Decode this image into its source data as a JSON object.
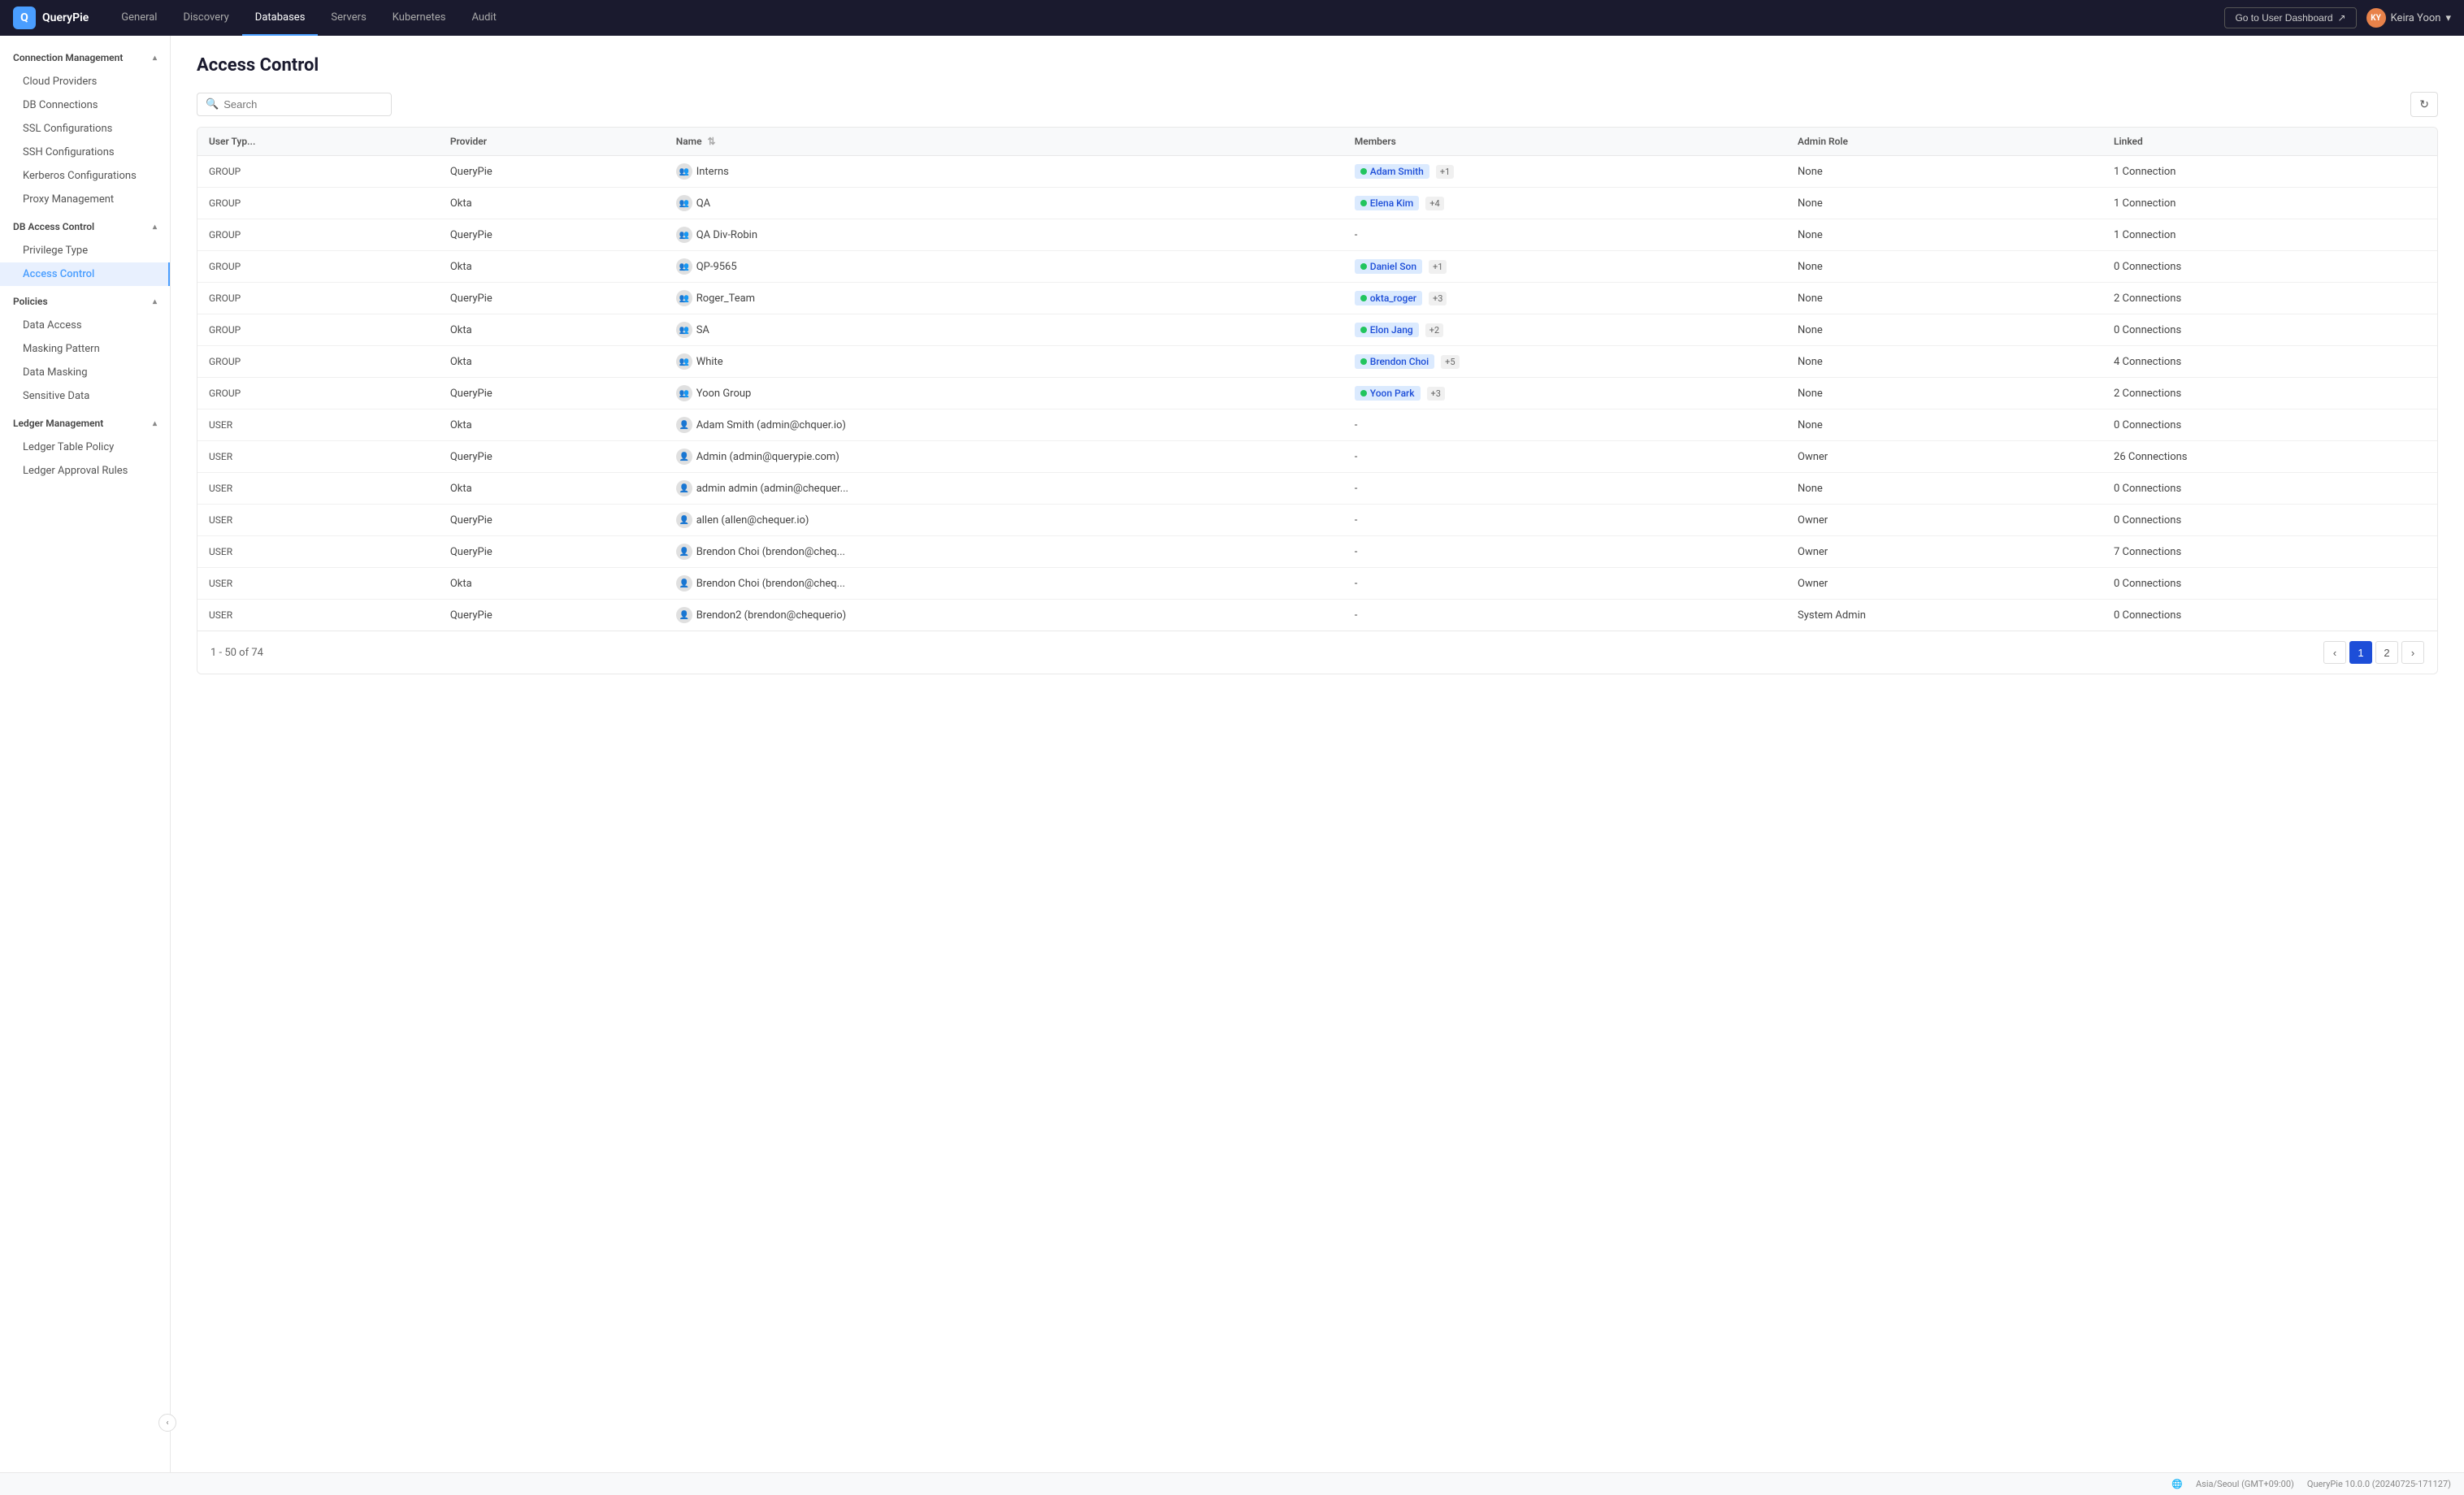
{
  "app": {
    "name": "QueryPie",
    "logo_char": "Q"
  },
  "nav": {
    "tabs": [
      {
        "id": "general",
        "label": "General",
        "active": false
      },
      {
        "id": "discovery",
        "label": "Discovery",
        "active": false
      },
      {
        "id": "databases",
        "label": "Databases",
        "active": true
      },
      {
        "id": "servers",
        "label": "Servers",
        "active": false
      },
      {
        "id": "kubernetes",
        "label": "Kubernetes",
        "active": false
      },
      {
        "id": "audit",
        "label": "Audit",
        "active": false
      }
    ],
    "dashboard_btn": "Go to User Dashboard",
    "user_name": "Keira Yoon",
    "user_initials": "KY"
  },
  "sidebar": {
    "sections": [
      {
        "id": "connection-management",
        "label": "Connection Management",
        "expanded": true,
        "items": [
          {
            "id": "cloud-providers",
            "label": "Cloud Providers",
            "active": false
          },
          {
            "id": "db-connections",
            "label": "DB Connections",
            "active": false
          },
          {
            "id": "ssl-configurations",
            "label": "SSL Configurations",
            "active": false
          },
          {
            "id": "ssh-configurations",
            "label": "SSH Configurations",
            "active": false
          },
          {
            "id": "kerberos-configurations",
            "label": "Kerberos Configurations",
            "active": false
          },
          {
            "id": "proxy-management",
            "label": "Proxy Management",
            "active": false
          }
        ]
      },
      {
        "id": "db-access-control",
        "label": "DB Access Control",
        "expanded": true,
        "items": [
          {
            "id": "privilege-type",
            "label": "Privilege Type",
            "active": false
          },
          {
            "id": "access-control",
            "label": "Access Control",
            "active": true
          }
        ]
      },
      {
        "id": "policies",
        "label": "Policies",
        "expanded": true,
        "items": [
          {
            "id": "data-access",
            "label": "Data Access",
            "active": false
          },
          {
            "id": "masking-pattern",
            "label": "Masking Pattern",
            "active": false
          },
          {
            "id": "data-masking",
            "label": "Data Masking",
            "active": false
          },
          {
            "id": "sensitive-data",
            "label": "Sensitive Data",
            "active": false
          }
        ]
      },
      {
        "id": "ledger-management",
        "label": "Ledger Management",
        "expanded": true,
        "items": [
          {
            "id": "ledger-table-policy",
            "label": "Ledger Table Policy",
            "active": false
          },
          {
            "id": "ledger-approval-rules",
            "label": "Ledger Approval Rules",
            "active": false
          }
        ]
      }
    ]
  },
  "page": {
    "title": "Access Control",
    "search_placeholder": "Search",
    "pagination_info": "1 - 50 of 74",
    "current_page": 1,
    "total_pages": 2
  },
  "table": {
    "columns": [
      {
        "id": "user-type",
        "label": "User Typ...",
        "sortable": false
      },
      {
        "id": "provider",
        "label": "Provider",
        "sortable": false
      },
      {
        "id": "name",
        "label": "Name",
        "sortable": true
      },
      {
        "id": "members",
        "label": "Members",
        "sortable": false
      },
      {
        "id": "admin-role",
        "label": "Admin Role",
        "sortable": false
      },
      {
        "id": "linked",
        "label": "Linked",
        "sortable": false
      }
    ],
    "rows": [
      {
        "user_type": "GROUP",
        "provider": "QueryPie",
        "name": "Interns",
        "members": [
          {
            "label": "Adam Smith",
            "has_dot": true
          }
        ],
        "members_plus": "+1",
        "admin_role": "None",
        "linked": "1 Connection"
      },
      {
        "user_type": "GROUP",
        "provider": "Okta",
        "name": "QA",
        "members": [
          {
            "label": "Elena Kim",
            "has_dot": true
          }
        ],
        "members_plus": "+4",
        "admin_role": "None",
        "linked": "1 Connection"
      },
      {
        "user_type": "GROUP",
        "provider": "QueryPie",
        "name": "QA Div-Robin",
        "members": [],
        "members_plus": "",
        "admin_role": "None",
        "linked": "1 Connection"
      },
      {
        "user_type": "GROUP",
        "provider": "Okta",
        "name": "QP-9565",
        "members": [
          {
            "label": "Daniel Son",
            "has_dot": true
          }
        ],
        "members_plus": "+1",
        "admin_role": "None",
        "linked": "0 Connections"
      },
      {
        "user_type": "GROUP",
        "provider": "QueryPie",
        "name": "Roger_Team",
        "members": [
          {
            "label": "okta_roger",
            "has_dot": true
          }
        ],
        "members_plus": "+3",
        "admin_role": "None",
        "linked": "2 Connections"
      },
      {
        "user_type": "GROUP",
        "provider": "Okta",
        "name": "SA",
        "members": [
          {
            "label": "Elon Jang",
            "has_dot": true
          }
        ],
        "members_plus": "+2",
        "admin_role": "None",
        "linked": "0 Connections"
      },
      {
        "user_type": "GROUP",
        "provider": "Okta",
        "name": "White",
        "members": [
          {
            "label": "Brendon Choi",
            "has_dot": true
          }
        ],
        "members_plus": "+5",
        "admin_role": "None",
        "linked": "4 Connections"
      },
      {
        "user_type": "GROUP",
        "provider": "QueryPie",
        "name": "Yoon Group",
        "members": [
          {
            "label": "Yoon Park",
            "has_dot": true
          }
        ],
        "members_plus": "+3",
        "admin_role": "None",
        "linked": "2 Connections"
      },
      {
        "user_type": "USER",
        "provider": "Okta",
        "name": "Adam Smith (admin@chquer.io)",
        "members": [],
        "members_plus": "",
        "admin_role": "None",
        "linked": "0 Connections"
      },
      {
        "user_type": "USER",
        "provider": "QueryPie",
        "name": "Admin (admin@querypie.com)",
        "members": [],
        "members_plus": "",
        "admin_role": "Owner",
        "linked": "26 Connections"
      },
      {
        "user_type": "USER",
        "provider": "Okta",
        "name": "admin admin (admin@chequer...",
        "members": [],
        "members_plus": "",
        "admin_role": "None",
        "linked": "0 Connections"
      },
      {
        "user_type": "USER",
        "provider": "QueryPie",
        "name": "allen (allen@chequer.io)",
        "members": [],
        "members_plus": "",
        "admin_role": "Owner",
        "linked": "0 Connections"
      },
      {
        "user_type": "USER",
        "provider": "QueryPie",
        "name": "Brendon Choi (brendon@cheq...",
        "members": [],
        "members_plus": "",
        "admin_role": "Owner",
        "linked": "7 Connections"
      },
      {
        "user_type": "USER",
        "provider": "Okta",
        "name": "Brendon Choi (brendon@cheq...",
        "members": [],
        "members_plus": "",
        "admin_role": "Owner",
        "linked": "0 Connections"
      },
      {
        "user_type": "USER",
        "provider": "QueryPie",
        "name": "Brendon2 (brendon@chequerio)",
        "members": [],
        "members_plus": "",
        "admin_role": "System Admin",
        "linked": "0 Connections"
      }
    ]
  },
  "status_bar": {
    "timezone": "Asia/Seoul (GMT+09:00)",
    "version": "QueryPie 10.0.0 (20240725-171127)"
  },
  "icons": {
    "search": "🔍",
    "refresh": "↻",
    "chevron_down": "▾",
    "chevron_up": "▴",
    "chevron_left": "‹",
    "chevron_right": "›",
    "external_link": "↗",
    "collapse": "‹",
    "sort": "⇅",
    "globe": "🌐"
  }
}
